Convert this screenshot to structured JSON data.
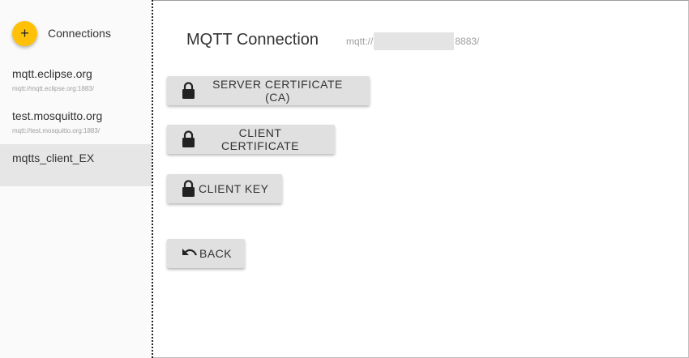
{
  "sidebar": {
    "title": "Connections",
    "add_icon": "+",
    "items": [
      {
        "name": "mqtt.eclipse.org",
        "url": "mqtt://mqtt.eclipse.org:1883/"
      },
      {
        "name": "test.mosquitto.org",
        "url": "mqtt://test.mosquitto.org:1883/"
      },
      {
        "name": "mqtts_client_EX",
        "url": ""
      }
    ]
  },
  "main": {
    "title": "MQTT Connection",
    "url_prefix": "mqtt://",
    "url_suffix": "8883/",
    "buttons": {
      "server_ca": "SERVER CERTIFICATE (CA)",
      "client_cert": "CLIENT CERTIFICATE",
      "client_key": "CLIENT KEY",
      "back": "BACK"
    }
  },
  "colors": {
    "accent": "#ffc107",
    "button_bg": "#e0e0e0",
    "selected_bg": "#e6e6e6"
  },
  "icons": {
    "lock": "lock-icon",
    "back": "undo-arrow-icon",
    "add": "plus-icon"
  }
}
